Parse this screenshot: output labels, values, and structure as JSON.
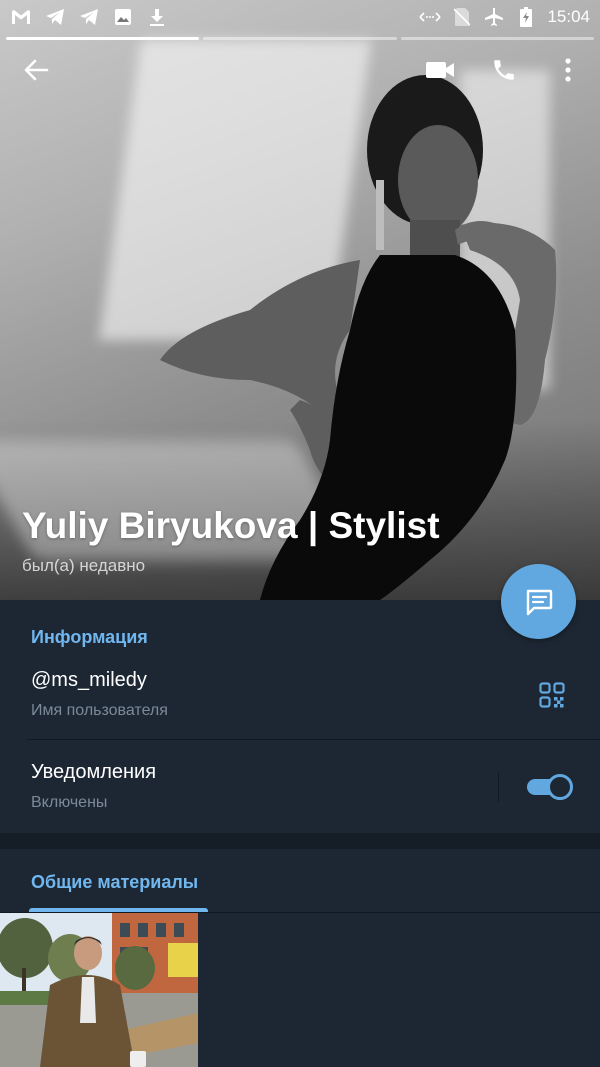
{
  "status_bar": {
    "time": "15:04",
    "left_icons": [
      "gmail-icon",
      "telegram-icon",
      "telegram-icon",
      "image-icon",
      "download-icon"
    ],
    "right_icons": [
      "data-saver-icon",
      "no-sim-icon",
      "airplane-icon",
      "battery-charging-icon"
    ]
  },
  "toolbar": {
    "back_icon": "arrow-left-icon",
    "video_icon": "video-call-icon",
    "call_icon": "phone-icon",
    "more_icon": "more-vert-icon"
  },
  "profile": {
    "name": "Yuliy Biryukova | Stylist",
    "last_seen": "был(а) недавно"
  },
  "info": {
    "title": "Информация",
    "username": "@ms_miledy",
    "username_label": "Имя пользователя",
    "notifications": "Уведомления",
    "notifications_state": "Включены",
    "notifications_on": true
  },
  "media": {
    "tab_label": "Общие материалы"
  },
  "colors": {
    "background": "#1d2733",
    "accent": "#71b7ef",
    "fab": "#62a8e0",
    "secondary_text": "#7b8a99"
  }
}
